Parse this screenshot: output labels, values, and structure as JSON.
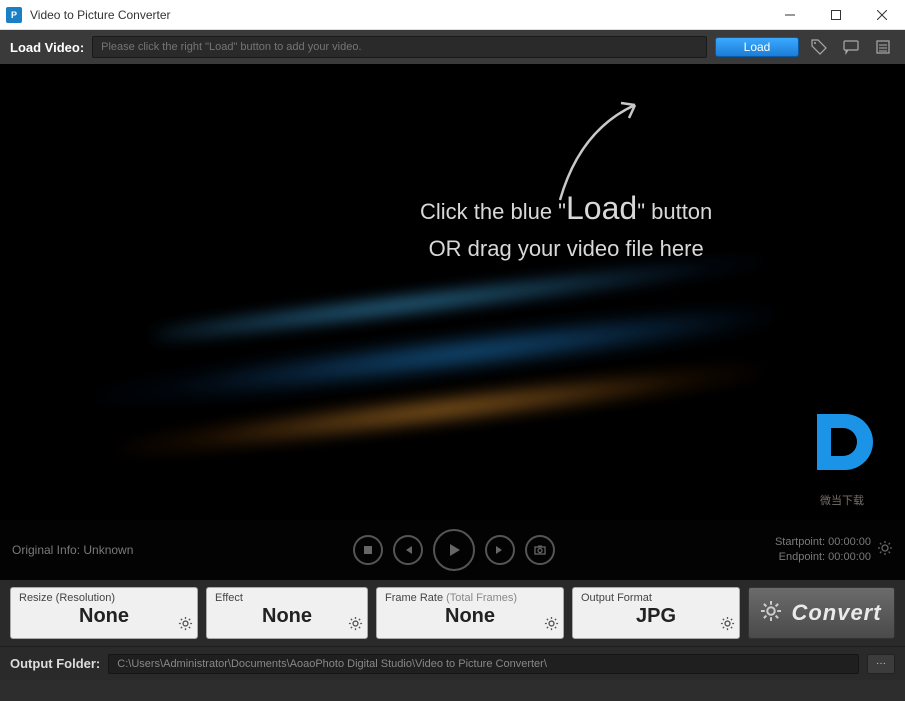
{
  "titlebar": {
    "title": "Video to Picture Converter",
    "icon_letter": "P"
  },
  "loadbar": {
    "label": "Load Video:",
    "placeholder": "Please click the right \"Load\" button to add your video.",
    "load_button": "Load"
  },
  "preview": {
    "hint_line1_a": "Click the blue \"",
    "hint_line1_b": "Load",
    "hint_line1_c": "\" button",
    "hint_line2": "OR drag your video file here",
    "original_info": "Original Info: Unknown",
    "startpoint_label": "Startpoint:",
    "startpoint_value": "00:00:00",
    "endpoint_label": "Endpoint:",
    "endpoint_value": "00:00:00"
  },
  "settings": {
    "resize": {
      "label": "Resize (Resolution)",
      "value": "None"
    },
    "effect": {
      "label": "Effect",
      "value": "None"
    },
    "frame": {
      "label_a": "Frame Rate ",
      "label_b": "(Total Frames)",
      "value": "None"
    },
    "output": {
      "label": "Output Format",
      "value": "JPG"
    },
    "convert_label": "Convert"
  },
  "output_folder": {
    "label": "Output Folder:",
    "path": "C:\\Users\\Administrator\\Documents\\AoaoPhoto Digital Studio\\Video to Picture Converter\\",
    "browse": "···"
  },
  "watermark_text": "微当下载"
}
